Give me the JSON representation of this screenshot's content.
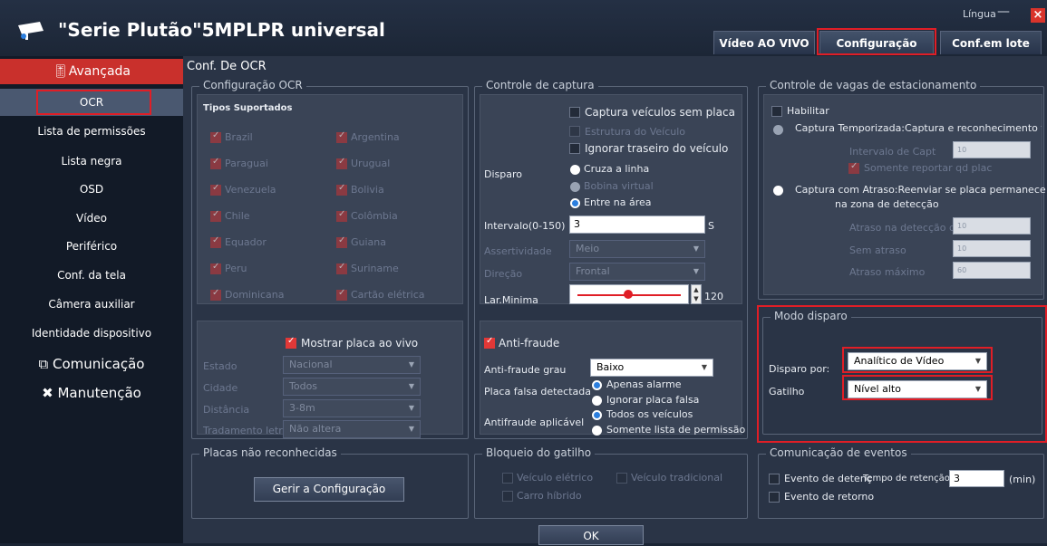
{
  "app": {
    "title": "\"Serie Plutão\"5MPLPR universal",
    "lingua": "Língua",
    "minimize": "—",
    "close": "×"
  },
  "tabs": [
    "Vídeo AO VIVO",
    "Configuração",
    "Conf.em lote"
  ],
  "sidebar": {
    "header": "Avançada",
    "items": [
      "OCR",
      "Lista de permissões",
      "Lista negra",
      "OSD",
      "Vídeo",
      "Periférico",
      "Conf. da tela",
      "Câmera auxiliar",
      "Identidade dispositivo",
      "Comunicação",
      "Manutenção"
    ]
  },
  "page_title": "Conf. De OCR",
  "ocr": {
    "title": "Configuração OCR",
    "tipos": "Tipos Suportados",
    "countries": [
      "Brazil",
      "Argentina",
      "Paraguai",
      "Urugual",
      "Venezuela",
      "Bolivia",
      "Chile",
      "Colômbia",
      "Equador",
      "Guiana",
      "Peru",
      "Suriname",
      "Dominicana",
      "Cartão elétrica"
    ],
    "mostrar": "Mostrar placa ao vivo",
    "estado_label": "Estado",
    "estado_value": "Nacional",
    "cidade_label": "Cidade",
    "cidade_value": "Todos",
    "distancia_label": "Distância",
    "distancia_value": "3-8m",
    "trat_label": "Tradamento letra",
    "trat_value": "Não altera"
  },
  "placas": {
    "title": "Placas não reconhecidas",
    "button": "Gerir a Configuração"
  },
  "captura": {
    "title": "Controle de captura",
    "sem_placa": "Captura veículos sem placa",
    "estrutura": "Estrutura do Veículo",
    "ignorar": "Ignorar traseiro do veículo",
    "disparo_label": "Disparo",
    "disparo_opts": [
      "Cruza a linha",
      "Bobina virtual",
      "Entre na área"
    ],
    "intervalo_label": "Intervalo(0-150)",
    "intervalo_value": "3",
    "intervalo_unit": "S",
    "assert_label": "Assertividade",
    "assert_value": "Meio",
    "direcao_label": "Direção",
    "direcao_value": "Frontal",
    "lar_label": "Lar.Minima",
    "lar_value": "120"
  },
  "antifraude": {
    "label": "Anti-fraude",
    "grau_label": "Anti-fraude grau",
    "grau_value": "Baixo",
    "placa_falsa_label": "Placa falsa detectada",
    "placa_falsa_opts": [
      "Apenas alarme",
      "Ignorar placa falsa"
    ],
    "aplicavel_label": "Antifraude aplicável",
    "aplicavel_opts": [
      "Todos os veículos",
      "Somente lista de permissão"
    ]
  },
  "bloqueio": {
    "title": "Bloqueio do gatilho",
    "opts": [
      "Veículo elétrico",
      "Veículo tradicional",
      "Carro híbrido"
    ]
  },
  "vagas": {
    "title": "Controle de vagas de estacionamento",
    "habilitar": "Habilitar",
    "temporizada": "Captura Temporizada:Captura e reconhecimento temp",
    "intervalo_capt": "Intervalo de Capt",
    "intervalo_capt_value": "10",
    "somente": "Somente reportar qd plac",
    "atraso": "Captura com Atraso:Reenviar se placa permanece",
    "atraso2": "na zona de detecção",
    "atraso_det": "Atraso na detecção de",
    "atraso_det_value": "10",
    "sem_atraso": "Sem atraso",
    "sem_atraso_value": "10",
    "atraso_max": "Atraso máximo",
    "atraso_max_value": "60"
  },
  "modo": {
    "title": "Modo disparo",
    "disparo_por_label": "Disparo por:",
    "disparo_por_value": "Analítico de Vídeo",
    "gatilho_label": "Gatilho",
    "gatilho_value": "Nível alto"
  },
  "eventos": {
    "title": "Comunicação de eventos",
    "detencao": "Evento de detenç",
    "retencao_label": "Tempo de retenção",
    "retencao_value": "3",
    "unit": "(min)",
    "retorno": "Evento de retorno"
  },
  "ok": "OK",
  "colors": {
    "accent_red": "#e01e26",
    "bg": "#2a3446",
    "sidebar": "#121a27"
  }
}
